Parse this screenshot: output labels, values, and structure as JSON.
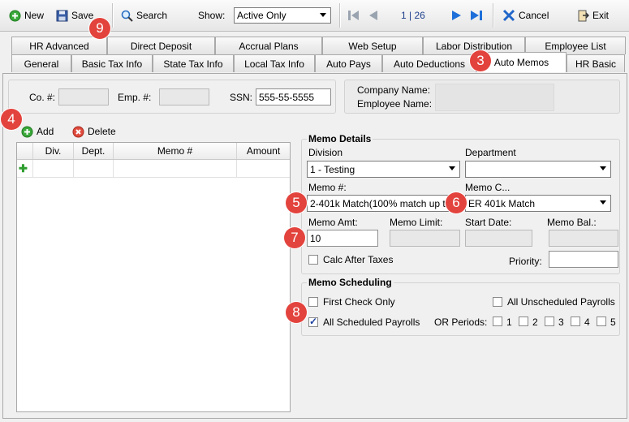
{
  "toolbar": {
    "new_label": "New",
    "save_label": "Save",
    "search_label": "Search",
    "show_label": "Show:",
    "show_value": "Active Only",
    "record_position": "1 | 26",
    "cancel_label": "Cancel",
    "exit_label": "Exit"
  },
  "tabs_row1": [
    "HR Advanced",
    "Direct Deposit",
    "Accrual Plans",
    "Web Setup",
    "Labor Distribution",
    "Employee List"
  ],
  "tabs_row2": [
    "General",
    "Basic Tax Info",
    "State Tax Info",
    "Local Tax Info",
    "Auto Pays",
    "Auto Deductions",
    "Auto Memos",
    "HR Basic"
  ],
  "active_tab": "Auto Memos",
  "header": {
    "co_label": "Co. #:",
    "co_value": "",
    "emp_label": "Emp. #:",
    "emp_value": "",
    "ssn_label": "SSN:",
    "ssn_value": "555-55-5555",
    "company_name_label": "Company Name:",
    "employee_name_label": "Employee Name:"
  },
  "list_actions": {
    "add_label": "Add",
    "delete_label": "Delete"
  },
  "grid": {
    "columns": [
      "Div.",
      "Dept.",
      "Memo #",
      "Amount"
    ]
  },
  "memo_details": {
    "title": "Memo Details",
    "division_label": "Division",
    "division_value": "1 - Testing",
    "department_label": "Department",
    "department_value": "",
    "memo_num_label": "Memo #:",
    "memo_num_value": "2-401k Match(100% match up t",
    "memo_code_label": "Memo C...",
    "memo_code_value": "ER 401k Match",
    "memo_amt_label": "Memo Amt:",
    "memo_amt_value": "10",
    "memo_limit_label": "Memo Limit:",
    "start_date_label": "Start Date:",
    "memo_bal_label": "Memo Bal.:",
    "calc_after_taxes_label": "Calc After Taxes",
    "calc_after_taxes_checked": false,
    "priority_label": "Priority:",
    "priority_value": ""
  },
  "memo_scheduling": {
    "title": "Memo Scheduling",
    "first_check_only_label": "First Check Only",
    "first_check_only_checked": false,
    "all_unscheduled_label": "All Unscheduled Payrolls",
    "all_unscheduled_checked": false,
    "all_scheduled_label": "All Scheduled Payrolls",
    "all_scheduled_checked": true,
    "or_periods_label": "OR Periods:",
    "periods": [
      "1",
      "2",
      "3",
      "4",
      "5"
    ]
  },
  "callouts": [
    "3",
    "4",
    "5",
    "6",
    "7",
    "8",
    "9"
  ],
  "colors": {
    "callout": "#e3433d",
    "nav_arrow": "#1e6fd9",
    "add_green": "#2e9e2e",
    "delete_red": "#d9362b"
  }
}
